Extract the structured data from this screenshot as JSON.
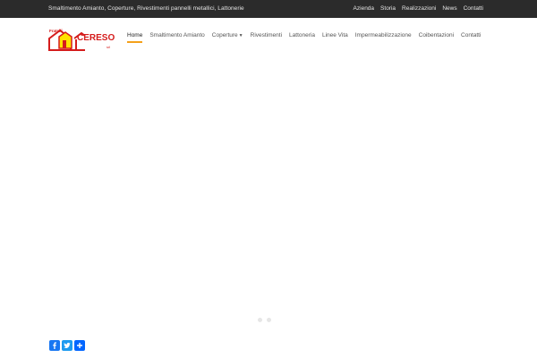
{
  "topbar": {
    "tagline": "Smaltimento Amianto, Coperture, Rivestimenti pannelli metallici, Lattonerie",
    "links": [
      "Azienda",
      "Storia",
      "Realizzazioni",
      "News",
      "Contatti"
    ]
  },
  "logo": {
    "top_text": "Fratelli",
    "brand": "CERESOLI",
    "suffix": "srl"
  },
  "nav": {
    "items": [
      {
        "label": "Home",
        "active": true
      },
      {
        "label": "Smaltimento Amianto"
      },
      {
        "label": "Coperture",
        "dropdown": true
      },
      {
        "label": "Rivestimenti"
      },
      {
        "label": "Lattoneria"
      },
      {
        "label": "Linee Vita"
      },
      {
        "label": "Impermeabilizzazione"
      },
      {
        "label": "Coibentazioni"
      },
      {
        "label": "Contatti"
      }
    ]
  },
  "slider": {
    "dots": 2
  },
  "share": {
    "buttons": [
      "facebook-icon",
      "twitter-icon",
      "share-plus-icon"
    ]
  },
  "colors": {
    "topbar_bg": "#2b2b2b",
    "accent": "#f4a11b",
    "logo_red": "#d51c1c",
    "logo_yellow": "#ffe200",
    "facebook": "#1877f2",
    "twitter": "#1d9bf0",
    "share": "#0166ff"
  }
}
